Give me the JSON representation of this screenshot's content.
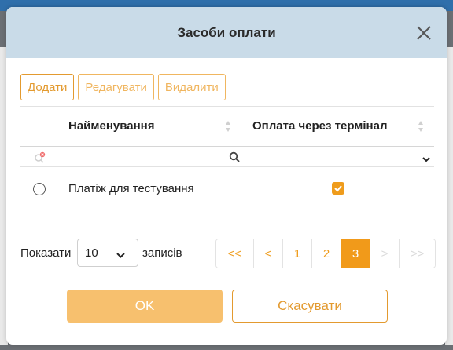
{
  "dialog": {
    "title": "Засоби оплати"
  },
  "toolbar": {
    "add_label": "Додати",
    "edit_label": "Редагувати",
    "delete_label": "Видалити"
  },
  "table": {
    "columns": [
      "Найменування",
      "Оплата через термінал"
    ],
    "rows": [
      {
        "name": "Платіж для тестування",
        "terminal": true,
        "selected": false
      }
    ]
  },
  "footer": {
    "show_label": "Показати",
    "page_size": "10",
    "records_label": "записів",
    "pages": [
      "<<",
      "<",
      "1",
      "2",
      "3",
      ">",
      ">>"
    ],
    "current_page": "3"
  },
  "buttons": {
    "ok_label": "OK",
    "cancel_label": "Скасувати"
  },
  "colors": {
    "accent": "#ef9c1c",
    "header_bg": "#c9dbe8"
  }
}
